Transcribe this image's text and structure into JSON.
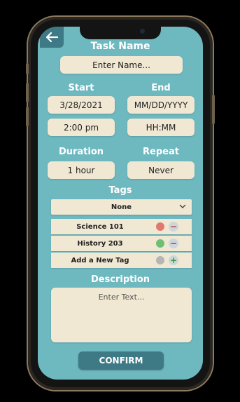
{
  "form": {
    "task_name_label": "Task Name",
    "task_name_placeholder": "Enter Name...",
    "start_label": "Start",
    "end_label": "End",
    "start_date": "3/28/2021",
    "end_date_placeholder": "MM/DD/YYYY",
    "start_time": "2:00 pm",
    "end_time_placeholder": "HH:MM",
    "duration_label": "Duration",
    "duration_value": "1 hour",
    "repeat_label": "Repeat",
    "repeat_value": "Never",
    "tags_label": "Tags",
    "tags_selected": "None",
    "tags": [
      {
        "name": "Science 101",
        "color": "#e07a6e",
        "action": "−"
      },
      {
        "name": "History 203",
        "color": "#6fbf73",
        "action": "−"
      },
      {
        "name": "Add a New Tag",
        "color": "#b5b5b5",
        "action": "+"
      }
    ],
    "description_label": "Description",
    "description_placeholder": "Enter Text...",
    "confirm_label": "CONFIRM"
  },
  "colors": {
    "background": "#6eb8c0",
    "accent": "#3e7a86",
    "field": "#f1e8d3"
  },
  "icons": {
    "back": "arrow-left-icon",
    "dropdown": "chevron-down-icon"
  }
}
